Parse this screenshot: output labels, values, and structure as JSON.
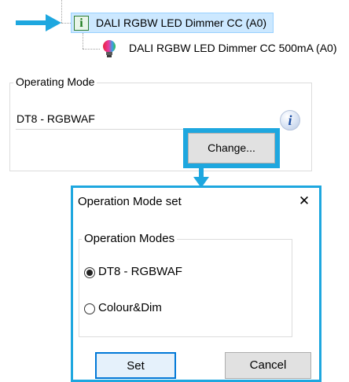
{
  "tree": {
    "parent_node_label": "DALI RGBW LED Dimmer CC (A0)",
    "child_node_label": "DALI RGBW LED Dimmer CC 500mA (A0)"
  },
  "operating_mode": {
    "group_label": "Operating Mode",
    "current_value": "DT8 - RGBWAF",
    "info_glyph": "i",
    "change_button_label": "Change..."
  },
  "dialog": {
    "title": "Operation Mode set",
    "close_glyph": "✕",
    "group_label": "Operation Modes",
    "options": [
      {
        "label": "DT8 - RGBWAF",
        "selected": true
      },
      {
        "label": "Colour&Dim",
        "selected": false
      }
    ],
    "set_button_label": "Set",
    "cancel_button_label": "Cancel"
  },
  "colors": {
    "highlight_blue": "#1ea7df",
    "selection_fill": "#cce8ff",
    "button_fill": "#e1e1e1"
  }
}
